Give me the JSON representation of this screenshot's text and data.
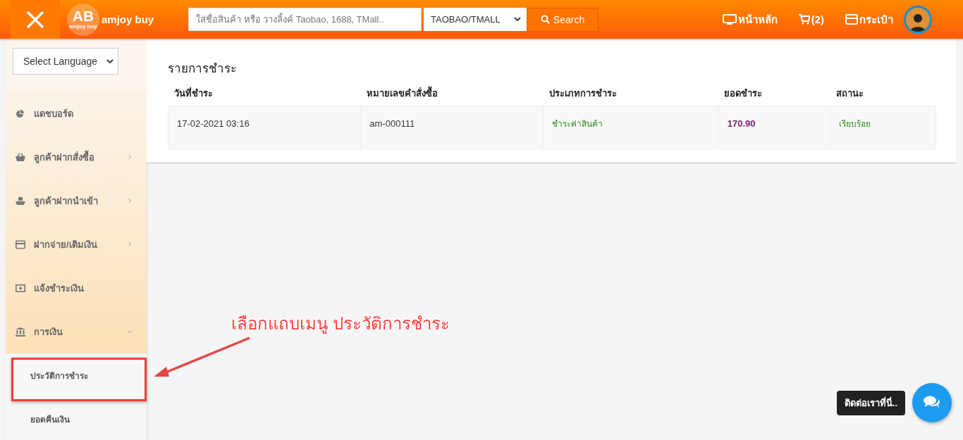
{
  "header": {
    "logo_badge": "AB",
    "logo_badge_small": "amjoy buy",
    "logo_text": "amjoy buy",
    "search": {
      "placeholder": "ใส่ชื่อสินค้า หรือ วางลิ้งค์ Taobao, 1688, TMall.."
    },
    "source_select": "TAOBAO/TMALL",
    "search_button": "Search",
    "nav": [
      {
        "kind": "home",
        "label": "หน้าหลัก"
      },
      {
        "kind": "cart",
        "label": "(2)"
      },
      {
        "kind": "wallet",
        "label": "กระเป๋า"
      }
    ]
  },
  "sidebar": {
    "language_select": "Select Language",
    "items": [
      {
        "kind": "link",
        "label": "แดชบอร์ด"
      },
      {
        "kind": "submenu",
        "label": "ลูกค้าฝากสั่งซื้อ",
        "expanded": false
      },
      {
        "kind": "submenu",
        "label": "ลูกค้าฝากนำเข้า",
        "expanded": false
      },
      {
        "kind": "submenu",
        "label": "ฝากจ่าย/เติมเงิน",
        "expanded": false
      },
      {
        "kind": "link",
        "label": "แจ้งชำระเงิน"
      },
      {
        "kind": "submenu",
        "label": "การเงิน",
        "expanded": true,
        "children": [
          {
            "label": "ประวัติการชำระ"
          },
          {
            "label": "ยอดคืนเงิน"
          }
        ]
      }
    ]
  },
  "payments": {
    "title": "รายการชำระ",
    "columns": [
      "วันที่ชำระ",
      "หมายเลขคำสั่งซื้อ",
      "ประเภทการชำระ",
      "ยอดชำระ",
      "สถานะ"
    ],
    "rows": [
      {
        "date": "17-02-2021 03:16",
        "order": "am-000111",
        "type": "ชำระค่าสินค้า",
        "amount": "170.90",
        "status": "เรียบร้อย"
      }
    ]
  },
  "annotation": {
    "text": "เลือกแถบเมนู ประวัติการชำระ"
  },
  "chat": {
    "label": "ติดต่อเราที่นี่.."
  }
}
